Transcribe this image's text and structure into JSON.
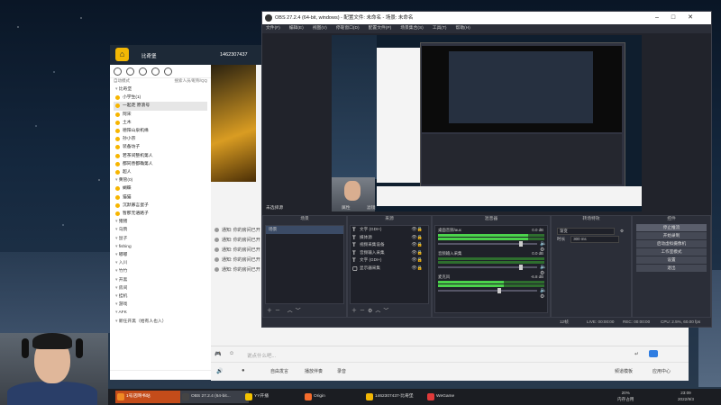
{
  "qq": {
    "nickname": "比奇堡",
    "qq_number": "1462307437",
    "members": "11",
    "mode": "自动模式",
    "filter": "搜索人员/昵称/QQ",
    "group_title": "比奇堡",
    "items": [
      {
        "type": "grp",
        "label": "比奇堡"
      },
      {
        "type": "row",
        "label": "小学生(1)"
      },
      {
        "type": "row",
        "label": "一起走 原浪号"
      },
      {
        "type": "row",
        "label": "阿宋"
      },
      {
        "type": "row",
        "label": "土木"
      },
      {
        "type": "row",
        "label": "德阳山泉机缘"
      },
      {
        "type": "row",
        "label": "孙小宗"
      },
      {
        "type": "row",
        "label": "装备坊子"
      },
      {
        "type": "row",
        "label": "若茶间整机第人"
      },
      {
        "type": "row",
        "label": "都同善都确第人"
      },
      {
        "type": "row",
        "label": "超人"
      },
      {
        "type": "grp",
        "label": "黄管(0)"
      },
      {
        "type": "row",
        "label": "蝴蝶"
      },
      {
        "type": "row",
        "label": "猫猫"
      },
      {
        "type": "row",
        "label": "沉默寡言蛋子"
      },
      {
        "type": "row",
        "label": "暂那无语路子"
      },
      {
        "type": "grp",
        "label": "猪猪"
      },
      {
        "type": "grp",
        "label": "乌鸦"
      },
      {
        "type": "grp",
        "label": "鼠子"
      },
      {
        "type": "grp",
        "label": "fishing"
      },
      {
        "type": "grp",
        "label": "嘟嘟"
      },
      {
        "type": "grp",
        "label": "入川"
      },
      {
        "type": "grp",
        "label": "竹竹"
      },
      {
        "type": "grp",
        "label": "开黑"
      },
      {
        "type": "grp",
        "label": "房间"
      },
      {
        "type": "grp",
        "label": "挂机"
      },
      {
        "type": "grp",
        "label": "游戏"
      },
      {
        "type": "grp",
        "label": "AFK"
      },
      {
        "type": "grp",
        "label": "新任开黑（给有人也入）"
      }
    ]
  },
  "chat": {
    "messages": [
      "通知: 你的房间已开",
      "通知: 你的房间已开",
      "通知: 你的房间已开",
      "通知: 你的房间已开",
      "通知: 你的房间已开"
    ],
    "input_placeholder": "说点什么吧...",
    "bottom_tools": [
      "自由发言",
      "播放伴奏",
      "录音"
    ],
    "right_tools": [
      "频道模板",
      "应用中心"
    ]
  },
  "obs": {
    "title": "OBS 27.2.4 (64-bit, windows) - 配置文件: 未命名 - 场景: 未命名",
    "menu": [
      "文件(F)",
      "编辑(E)",
      "视图(V)",
      "停靠窗口(D)",
      "配置文件(P)",
      "场景集合(S)",
      "工具(T)",
      "帮助(H)"
    ],
    "toolbar": [
      "未选择源",
      "属性",
      "滤镜"
    ],
    "docks": {
      "scenes": {
        "title": "场景",
        "items": [
          "场景"
        ]
      },
      "sources": {
        "title": "来源",
        "items": [
          {
            "icon": "T",
            "label": "文字 (GDI+)"
          },
          {
            "icon": "T",
            "label": "媒体源"
          },
          {
            "icon": "T",
            "label": "视频采集设备"
          },
          {
            "icon": "T",
            "label": "音频输入采集"
          },
          {
            "icon": "T",
            "label": "文字 (GDI+)"
          },
          {
            "icon": "▢",
            "label": "显示器采集"
          }
        ]
      },
      "mixer": {
        "title": "混音器",
        "channels": [
          {
            "name": "桌面音频/aux",
            "db": "0.0 dB",
            "level": 0.85,
            "vol": 0.82
          },
          {
            "name": "音频输入采集",
            "db": "0.0 dB",
            "level": 0.0,
            "vol": 0.82
          },
          {
            "name": "麦克风",
            "db": "-6.8 dB",
            "level": 0.62,
            "vol": 0.6
          }
        ]
      },
      "transitions": {
        "title": "转场特效",
        "type": "渐变",
        "duration_label": "时长",
        "duration": "300 ms"
      },
      "controls": {
        "title": "控件",
        "buttons": [
          "停止推流",
          "开始录制",
          "启动虚拟摄像机",
          "工作室模式",
          "设置",
          "退出"
        ]
      }
    },
    "status": {
      "live": "LIVE: 00:00:00",
      "rec": "REC: 00:00:00",
      "cpu": "CPU: 2.5%, 60.00 fps",
      "dropped": "12帧"
    }
  },
  "taskbar": {
    "tasks": [
      {
        "label": "1号店网书站",
        "color": "#f08a24",
        "active": true
      },
      {
        "label": "OBS 27.2.4 (64-bit...",
        "color": "#444",
        "hl": true
      },
      {
        "label": "YY开播",
        "color": "#f3c200"
      },
      {
        "label": "Origin",
        "color": "#f56c2d"
      },
      {
        "label": "1462307437-比奇堡",
        "color": "#f2b705"
      },
      {
        "label": "WeGame",
        "color": "#e03a3a"
      }
    ],
    "cpu": "20%",
    "cpu_label": "内存占用",
    "time": "23:09",
    "date": "2022/9/3"
  }
}
